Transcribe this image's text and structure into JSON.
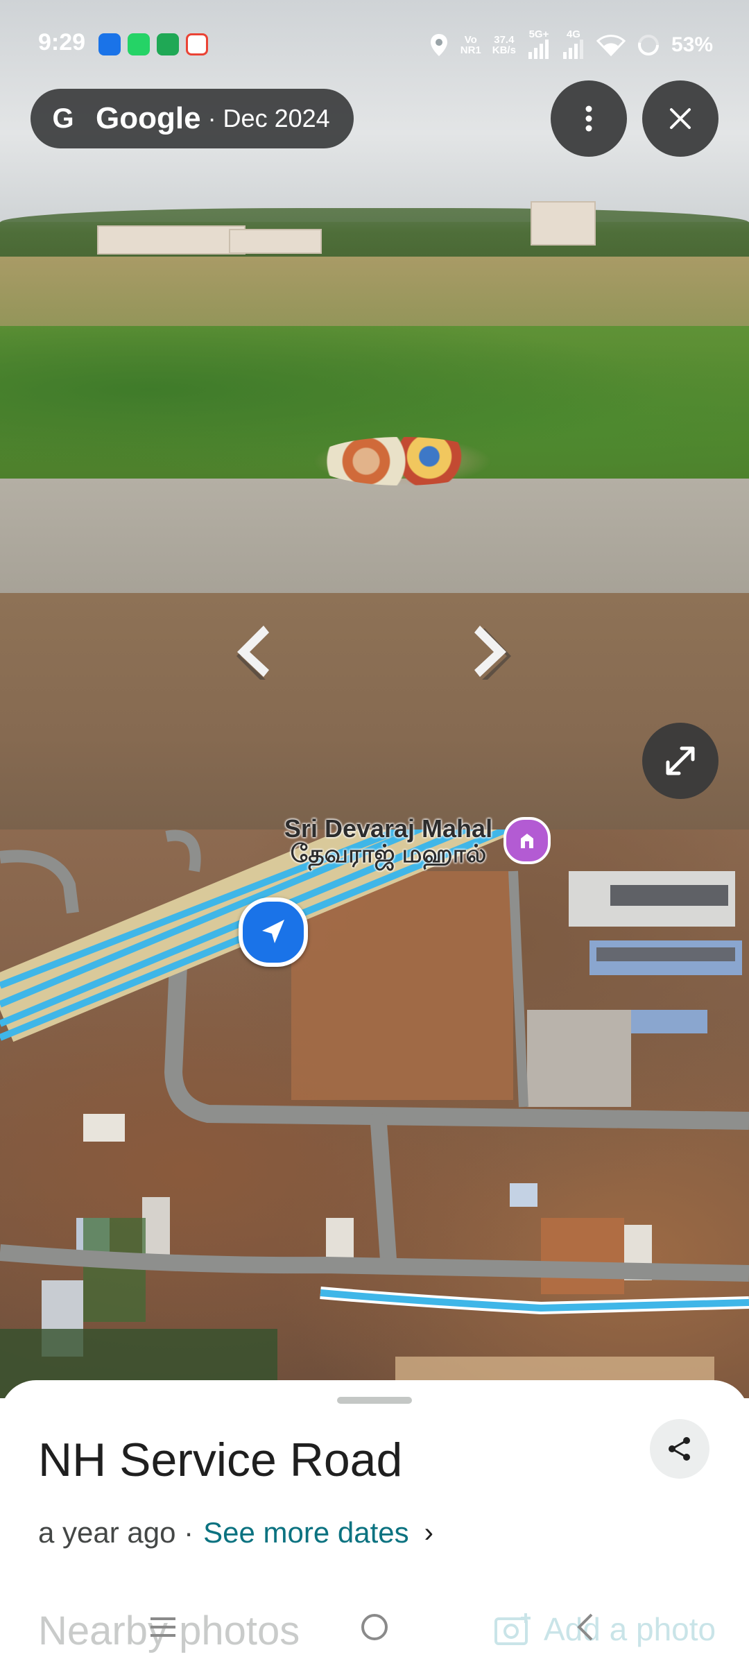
{
  "status_bar": {
    "time": "9:29",
    "network_vo": "Vo",
    "network_nr": "NR1",
    "speed_value": "37.4",
    "speed_unit": "KB/s",
    "net_5g": "5G+",
    "net_4g": "4G",
    "battery": "53%"
  },
  "imagery": {
    "brand": "Google",
    "date": "· Dec 2024"
  },
  "map": {
    "label_line1": "Sri Devaraj Mahal",
    "label_line2": "தேவராஜ் மஹால்"
  },
  "sheet": {
    "title": "NH Service Road",
    "age": "a year ago ·",
    "see_more": "See more dates",
    "nearby": "Nearby photos",
    "add_photo": "Add a photo"
  },
  "colors": {
    "accent_link": "#0b7280",
    "location_blue": "#1a73e8",
    "route_blue": "#3fb6e8",
    "poi_purple": "#b35bd3"
  },
  "icons": [
    "message-icon",
    "whatsapp-icon",
    "whatsapp-business-icon",
    "gmail-icon",
    "location-icon",
    "wifi-icon",
    "battery-icon",
    "google-g-icon",
    "more-vert-icon",
    "close-icon",
    "fullscreen-icon",
    "chevron-left-icon",
    "chevron-right-icon",
    "share-icon",
    "chevron-right-small-icon",
    "add-photo-icon",
    "nav-menu-icon",
    "nav-home-icon",
    "nav-back-icon"
  ]
}
